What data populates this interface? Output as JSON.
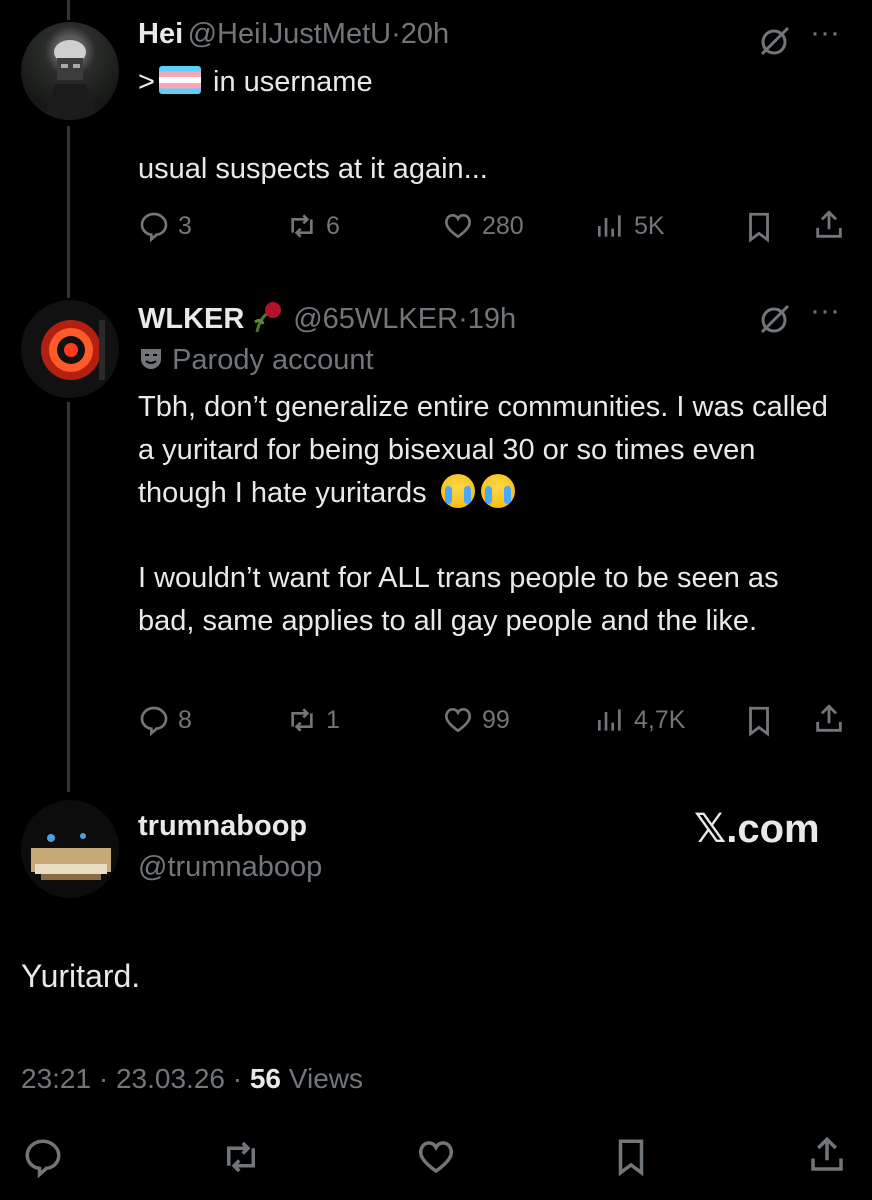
{
  "tweet1": {
    "name": "Hei",
    "handle": "@HeiIJustMetU",
    "sep": "·",
    "time": "20h",
    "line1_prefix": ">",
    "line1_suffix": "in username",
    "body": "usual suspects at it again...",
    "replies": "3",
    "reposts": "6",
    "likes": "280",
    "views": "5K"
  },
  "tweet2": {
    "name": "WLKER",
    "handle": "@65WLKER",
    "sep": "·",
    "time": "19h",
    "badge": "Parody account",
    "para1": "Tbh, don’t generalize entire communities. I was called a yuritard for being bisexual 30 or so times even though I hate yuritards",
    "para2": "I wouldn’t want for ALL trans people to be seen as bad, same applies to all gay people and the like.",
    "replies": "8",
    "reposts": "1",
    "likes": "99",
    "views": "4,7K"
  },
  "main_tweet": {
    "name": "trumnaboop",
    "handle": "@trumnaboop",
    "watermark": "𝕏.com",
    "body": "Yuritard.",
    "time": "23:21",
    "date": "23.03.26",
    "sep": "·",
    "views_count": "56",
    "views_label": "Views"
  },
  "colors": {
    "background": "#000000",
    "text": "#e7e9ea",
    "secondary": "#71767b",
    "thread_line": "#333639"
  }
}
